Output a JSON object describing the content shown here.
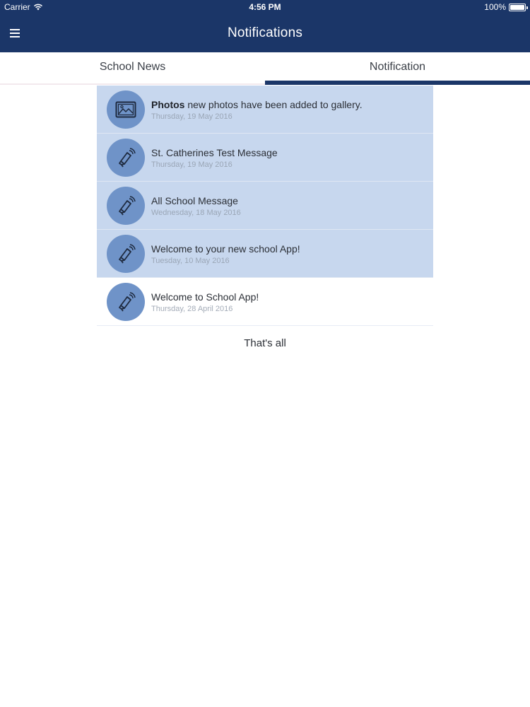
{
  "status_bar": {
    "carrier": "Carrier",
    "time": "4:56 PM",
    "battery": "100%"
  },
  "nav": {
    "title": "Notifications",
    "menu_icon": "hamburger-menu-icon"
  },
  "tabs": [
    {
      "label": "School News",
      "active": false
    },
    {
      "label": "Notification",
      "active": true
    }
  ],
  "notifications": [
    {
      "icon": "photo-gallery-icon",
      "bold_prefix": "Photos",
      "title": " new photos have been added to gallery.",
      "date": "Thursday, 19 May 2016",
      "unread": true
    },
    {
      "icon": "megaphone-icon",
      "bold_prefix": "",
      "title": "St. Catherines Test Message",
      "date": "Thursday, 19 May 2016",
      "unread": true
    },
    {
      "icon": "megaphone-icon",
      "bold_prefix": "",
      "title": "All School Message",
      "date": "Wednesday, 18 May 2016",
      "unread": true
    },
    {
      "icon": "megaphone-icon",
      "bold_prefix": "",
      "title": "Welcome to your new school App!",
      "date": "Tuesday, 10 May 2016",
      "unread": true
    },
    {
      "icon": "megaphone-icon",
      "bold_prefix": "",
      "title": "Welcome to School App!",
      "date": "Thursday, 28 April 2016",
      "unread": false
    }
  ],
  "footer": {
    "end_text": "That's all"
  },
  "colors": {
    "nav_bg": "#1b3668",
    "unread_bg": "#c7d7ee",
    "avatar_bg": "#6f93c8"
  }
}
